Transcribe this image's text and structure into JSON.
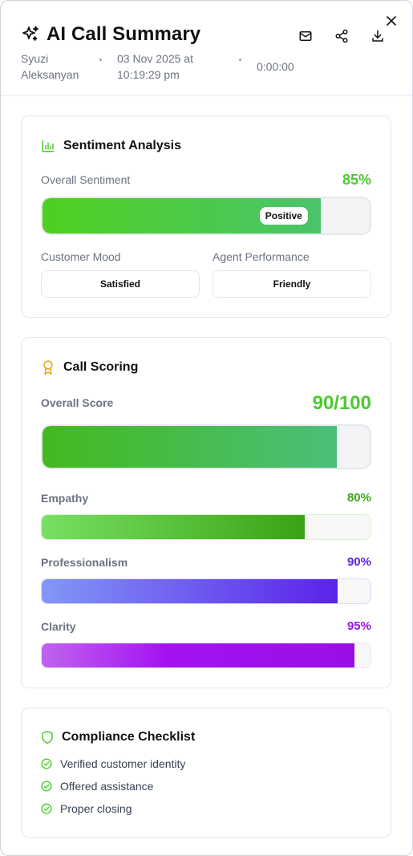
{
  "header": {
    "title": "AI Call Summary",
    "user_line1": "Syuzi",
    "user_line2": "Aleksanyan",
    "date_line1": "03 Nov 2025 at",
    "date_line2": "10:19:29 pm",
    "duration": "0:00:00",
    "icons": [
      "sparkles-icon",
      "mail-icon",
      "share-icon",
      "download-icon",
      "close-icon"
    ]
  },
  "sentiment": {
    "title": "Sentiment Analysis",
    "overall_label": "Overall Sentiment",
    "overall_value": "85%",
    "overall_fraction": 0.85,
    "badge": "Positive",
    "mood_label": "Customer Mood",
    "mood_value": "Satisfied",
    "agent_label": "Agent Performance",
    "agent_value": "Friendly",
    "accent": "#4cc92f"
  },
  "scoring": {
    "title": "Call Scoring",
    "overall_label": "Overall Score",
    "overall_value": "90/100",
    "overall_fraction": 0.9,
    "metrics": [
      {
        "label": "Empathy",
        "value": "80%",
        "fraction": 0.8,
        "color": "#3ba812"
      },
      {
        "label": "Professionalism",
        "value": "90%",
        "fraction": 0.9,
        "color": "#5b21e6"
      },
      {
        "label": "Clarity",
        "value": "95%",
        "fraction": 0.95,
        "color": "#9b12e6"
      }
    ]
  },
  "compliance": {
    "title": "Compliance Checklist",
    "items": [
      "Verified customer identity",
      "Offered assistance",
      "Proper closing"
    ]
  }
}
